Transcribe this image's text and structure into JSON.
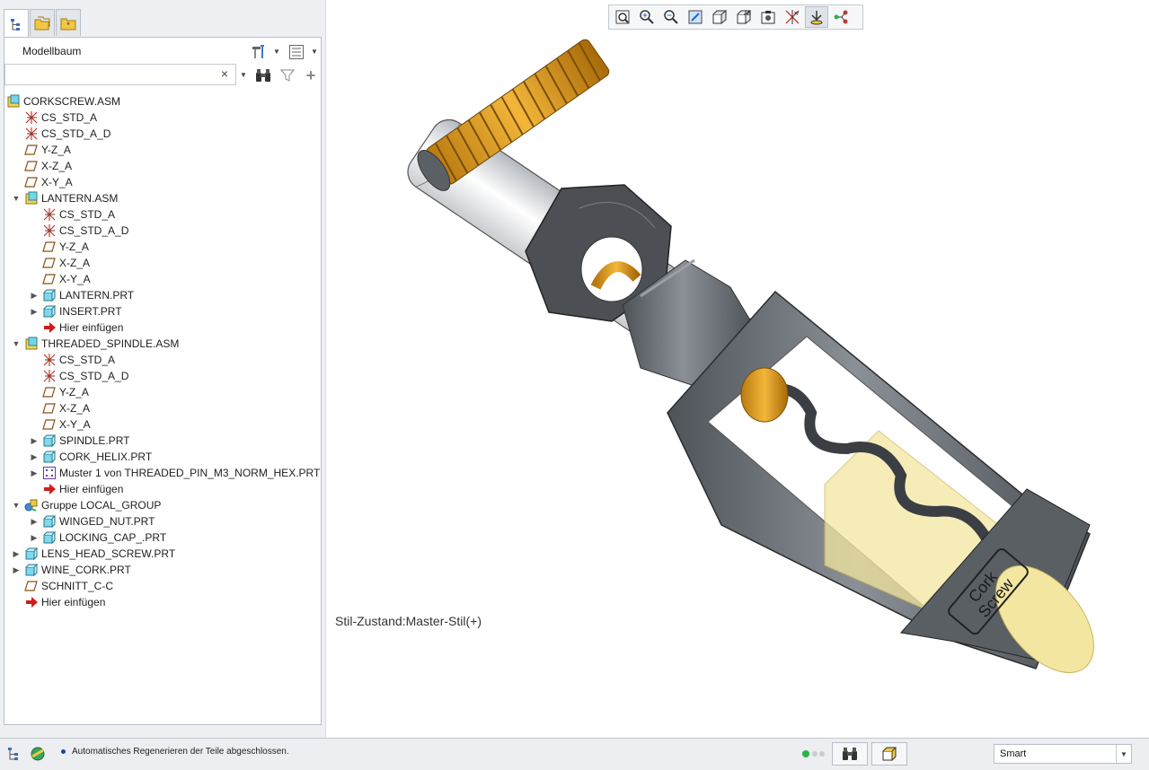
{
  "panel": {
    "title": "Modellbaum",
    "search_value": "",
    "clear_glyph": "×"
  },
  "tree": [
    {
      "label": "CORKSCREW.ASM",
      "icon": "assembly-icon",
      "level": 0,
      "expander": "none"
    },
    {
      "label": "CS_STD_A",
      "icon": "csys-icon",
      "level": 1,
      "expander": "none"
    },
    {
      "label": "CS_STD_A_D",
      "icon": "csys-icon",
      "level": 1,
      "expander": "none"
    },
    {
      "label": "Y-Z_A",
      "icon": "datum-plane-icon",
      "level": 1,
      "expander": "none"
    },
    {
      "label": "X-Z_A",
      "icon": "datum-plane-icon",
      "level": 1,
      "expander": "none"
    },
    {
      "label": "X-Y_A",
      "icon": "datum-plane-icon",
      "level": 1,
      "expander": "none"
    },
    {
      "label": "LANTERN.ASM",
      "icon": "assembly-icon",
      "level": 1,
      "expander": "expanded"
    },
    {
      "label": "CS_STD_A",
      "icon": "csys-icon",
      "level": 2,
      "expander": "none"
    },
    {
      "label": "CS_STD_A_D",
      "icon": "csys-icon",
      "level": 2,
      "expander": "none"
    },
    {
      "label": "Y-Z_A",
      "icon": "datum-plane-icon",
      "level": 2,
      "expander": "none"
    },
    {
      "label": "X-Z_A",
      "icon": "datum-plane-icon",
      "level": 2,
      "expander": "none"
    },
    {
      "label": "X-Y_A",
      "icon": "datum-plane-icon",
      "level": 2,
      "expander": "none"
    },
    {
      "label": "LANTERN.PRT",
      "icon": "part-icon",
      "level": 2,
      "expander": "collapsed"
    },
    {
      "label": "INSERT.PRT",
      "icon": "part-icon",
      "level": 2,
      "expander": "collapsed"
    },
    {
      "label": "Hier einfügen",
      "icon": "insert-here-icon",
      "level": 2,
      "expander": "none"
    },
    {
      "label": "THREADED_SPINDLE.ASM",
      "icon": "assembly-icon",
      "level": 1,
      "expander": "expanded"
    },
    {
      "label": "CS_STD_A",
      "icon": "csys-icon",
      "level": 2,
      "expander": "none"
    },
    {
      "label": "CS_STD_A_D",
      "icon": "csys-icon",
      "level": 2,
      "expander": "none"
    },
    {
      "label": "Y-Z_A",
      "icon": "datum-plane-icon",
      "level": 2,
      "expander": "none"
    },
    {
      "label": "X-Z_A",
      "icon": "datum-plane-icon",
      "level": 2,
      "expander": "none"
    },
    {
      "label": "X-Y_A",
      "icon": "datum-plane-icon",
      "level": 2,
      "expander": "none"
    },
    {
      "label": "SPINDLE.PRT",
      "icon": "part-icon",
      "level": 2,
      "expander": "collapsed"
    },
    {
      "label": "CORK_HELIX.PRT",
      "icon": "part-icon",
      "level": 2,
      "expander": "collapsed"
    },
    {
      "label": "Muster 1 von THREADED_PIN_M3_NORM_HEX.PRT",
      "icon": "pattern-icon",
      "level": 2,
      "expander": "collapsed"
    },
    {
      "label": "Hier einfügen",
      "icon": "insert-here-icon",
      "level": 2,
      "expander": "none"
    },
    {
      "label": "Gruppe LOCAL_GROUP",
      "icon": "group-icon",
      "level": 1,
      "expander": "expanded"
    },
    {
      "label": "WINGED_NUT.PRT",
      "icon": "part-icon",
      "level": 2,
      "expander": "collapsed"
    },
    {
      "label": "LOCKING_CAP_.PRT",
      "icon": "part-icon",
      "level": 2,
      "expander": "collapsed"
    },
    {
      "label": "LENS_HEAD_SCREW.PRT",
      "icon": "part-icon",
      "level": 1,
      "expander": "collapsed"
    },
    {
      "label": "WINE_CORK.PRT",
      "icon": "part-icon",
      "level": 1,
      "expander": "collapsed"
    },
    {
      "label": "SCHNITT_C-C",
      "icon": "datum-plane-icon",
      "level": 1,
      "expander": "none"
    },
    {
      "label": "Hier einfügen",
      "icon": "insert-here-icon",
      "level": 1,
      "expander": "none"
    }
  ],
  "viewport": {
    "style_state": "Stil-Zustand:Master-Stil(+)",
    "model_label": [
      "Cork",
      "Screw"
    ]
  },
  "view_toolbar": [
    "refit-icon",
    "zoom-in-icon",
    "zoom-out-icon",
    "repaint-icon",
    "display-style-icon",
    "saved-views-icon",
    "view-manager-icon",
    "datum-display-icon",
    "spin-center-icon",
    "annotation-display-icon"
  ],
  "status": {
    "message": "Automatisches Regenerieren der Teile abgeschlossen.",
    "selection_filter": "Smart"
  },
  "colors": {
    "accent_blue": "#1a3fbf",
    "thread_orange": "#e8a21a",
    "body_gray": "#6d7378",
    "cork_yellow": "#f3e6a0",
    "status_green": "#2db24a",
    "insert_red": "#d01c1c"
  }
}
